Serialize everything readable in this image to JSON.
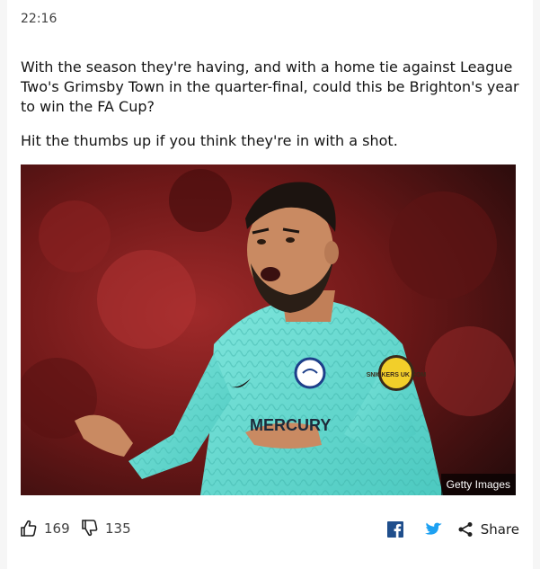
{
  "post": {
    "time": "22:16",
    "paragraphs": [
      "With the season they're having, and with a home tie against League Two's Grimsby Town in the quarter-final, could this be Brighton's year to win the FA Cup?",
      "Hit the thumbs up if you think they're in with a shot."
    ],
    "image": {
      "credit": "Getty Images",
      "shirt_sponsor": "MERCURY",
      "sleeve_badge": "SNICKERS UK COM"
    }
  },
  "reactions": {
    "thumbs_up_count": "169",
    "thumbs_down_count": "135"
  },
  "share": {
    "label": "Share",
    "facebook_icon": "facebook-icon",
    "twitter_icon": "twitter-icon",
    "share_icon": "share-icon"
  },
  "colors": {
    "facebook": "#1877f2",
    "twitter": "#1da1f2",
    "text": "#141414",
    "muted": "#404040"
  }
}
